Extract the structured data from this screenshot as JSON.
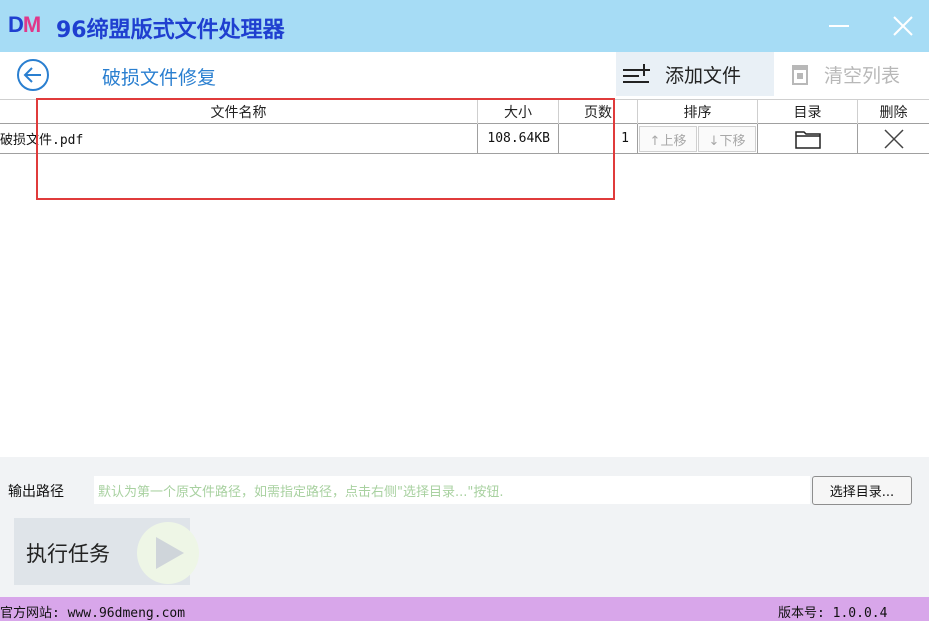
{
  "app": {
    "logo_d": "D",
    "logo_m": "M",
    "title": "96缔盟版式文件处理器"
  },
  "toolbar": {
    "heading": "破损文件修复",
    "add_label": "添加文件",
    "clear_label": "清空列表"
  },
  "table": {
    "headers": {
      "name": "文件名称",
      "size": "大小",
      "pages": "页数",
      "sort": "排序",
      "dir": "目录",
      "del": "删除"
    },
    "rows": [
      {
        "name": "破损文件.pdf",
        "size": "108.64KB",
        "pages": "1",
        "up_label": "↑上移",
        "down_label": "↓下移"
      }
    ]
  },
  "output": {
    "label": "输出路径",
    "placeholder": "默认为第一个原文件路径，如需指定路径，点击右侧\"选择目录...\"按钮.",
    "choose_label": "选择目录...",
    "run_label": "执行任务"
  },
  "status": {
    "site": "官方网站:  www.96dmeng.com",
    "version": "版本号: 1.0.0.4"
  },
  "colors": {
    "titlebar": "#a6dcf5",
    "accent": "#2a7fd0",
    "statusbar": "#d8a6ea",
    "highlight_box": "#e03b3b"
  },
  "icons": [
    "back-arrow-icon",
    "add-list-icon",
    "trash-icon",
    "minimize-icon",
    "close-icon",
    "folder-icon",
    "delete-x-icon",
    "play-icon"
  ]
}
